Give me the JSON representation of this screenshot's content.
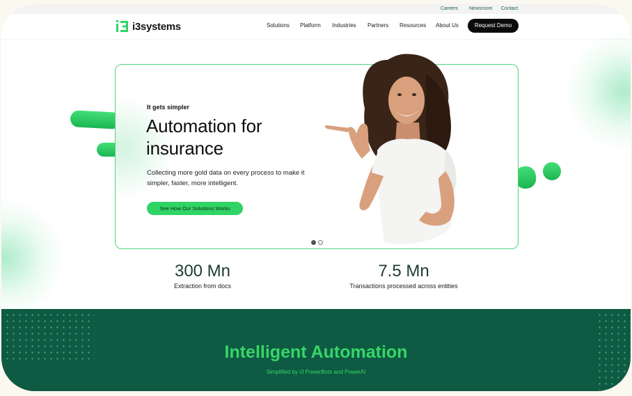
{
  "utility_nav": [
    "Careers",
    "Newsroom",
    "Contact"
  ],
  "brand": {
    "name": "i3systems",
    "accent": "#2fd465",
    "dark": "#0e5a43"
  },
  "nav": {
    "items": [
      "Solutions",
      "Platform",
      "Industries",
      "Partners",
      "Resources",
      "About Us"
    ],
    "cta": "Request Demo"
  },
  "hero": {
    "eyebrow": "It gets simpler",
    "title": "Automation for insurance",
    "description": "Collecting more gold data on every process to make it simpler, faster, more intelligent.",
    "cta": "See How Our Solutions Works",
    "carousel": {
      "slides": 2,
      "active": 1
    }
  },
  "stats": [
    {
      "value": "300 Mn",
      "label": "Extraction from docs"
    },
    {
      "value": "7.5 Mn",
      "label": "Transactions processed across entities"
    }
  ],
  "section": {
    "title": "Intelligent Automation",
    "subtitle": "Simplified by i3 PowerBots and PowerAI"
  },
  "icons": [
    "i3-logo-icon",
    "pointing-woman-illustration"
  ]
}
